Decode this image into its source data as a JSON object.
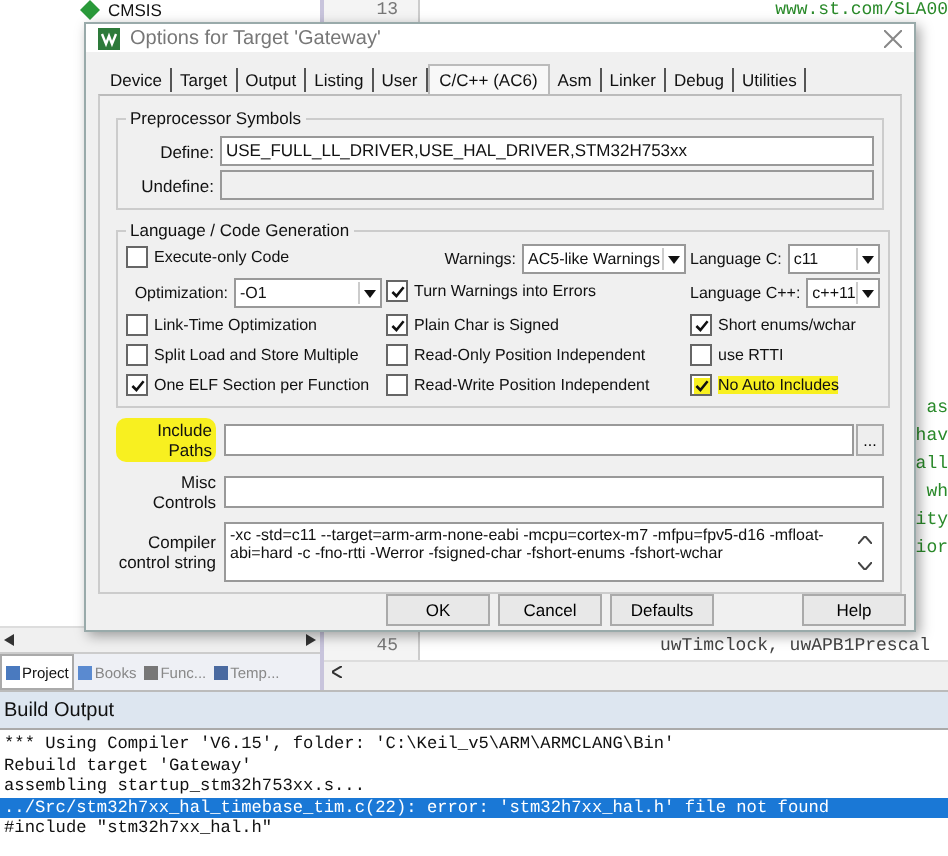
{
  "ide": {
    "tree_item": "CMSIS",
    "top_line_numbers": [
      "13"
    ],
    "top_code": "www.st.com/SLA00",
    "right_code_fragments": [
      "as",
      "hav",
      "all",
      "wh",
      "ity",
      "ior"
    ],
    "bottom_line_numbers": [
      "45"
    ],
    "bottom_code": "uwTimclock, uwAPB1Prescal",
    "panel_tabs": [
      {
        "label": "Project",
        "selected": true
      },
      {
        "label": "Books",
        "selected": false
      },
      {
        "label": "Func...",
        "selected": false
      },
      {
        "label": "Temp...",
        "selected": false
      }
    ]
  },
  "dialog": {
    "title": "Options for Target 'Gateway'",
    "tabs": [
      {
        "label": "Device",
        "selected": false
      },
      {
        "label": "Target",
        "selected": false
      },
      {
        "label": "Output",
        "selected": false
      },
      {
        "label": "Listing",
        "selected": false
      },
      {
        "label": "User",
        "selected": false
      },
      {
        "label": "C/C++ (AC6)",
        "selected": true
      },
      {
        "label": "Asm",
        "selected": false
      },
      {
        "label": "Linker",
        "selected": false
      },
      {
        "label": "Debug",
        "selected": false
      },
      {
        "label": "Utilities",
        "selected": false
      }
    ],
    "preprocessor": {
      "title": "Preprocessor Symbols",
      "fields": [
        {
          "label": "Define:",
          "value": "USE_FULL_LL_DRIVER,USE_HAL_DRIVER,STM32H753xx"
        },
        {
          "label": "Undefine:"
        }
      ]
    },
    "language": {
      "title": "Language / Code Generation",
      "items": [
        {
          "kind": "checkbox",
          "label": "Execute-only Code",
          "checked": false,
          "highlighted": false
        },
        {
          "kind": "select",
          "label": "Warnings:",
          "value": "AC5-like Warnings"
        },
        {
          "kind": "select",
          "label": "Language C:",
          "value": "c11"
        },
        {
          "kind": "select",
          "label": "Optimization:",
          "value": "-O1"
        },
        {
          "kind": "checkbox",
          "label": "Turn Warnings into Errors",
          "checked": true,
          "highlighted": false
        },
        {
          "kind": "select",
          "label": "Language C++:",
          "value": "c++11"
        },
        {
          "kind": "checkbox",
          "label": "Link-Time Optimization",
          "checked": false,
          "highlighted": false
        },
        {
          "kind": "checkbox",
          "label": "Plain Char is Signed",
          "checked": true,
          "highlighted": false
        },
        {
          "kind": "checkbox",
          "label": "Short enums/wchar",
          "checked": true,
          "highlighted": false
        },
        {
          "kind": "checkbox",
          "label": "Split Load and Store Multiple",
          "checked": false,
          "highlighted": false
        },
        {
          "kind": "checkbox",
          "label": "Read-Only Position Independent",
          "checked": false,
          "highlighted": false
        },
        {
          "kind": "checkbox",
          "label": "use RTTI",
          "checked": false,
          "highlighted": false
        },
        {
          "kind": "checkbox",
          "label": "One ELF Section per Function",
          "checked": true,
          "highlighted": false
        },
        {
          "kind": "checkbox",
          "label": "Read-Write Position Independent",
          "checked": false,
          "highlighted": false
        },
        {
          "kind": "checkbox",
          "label": "No Auto Includes",
          "checked": true,
          "highlighted": true
        }
      ]
    },
    "include_paths": {
      "label": "Include Paths",
      "highlighted": true,
      "browse": "..."
    },
    "misc_controls": {
      "label": "Misc Controls",
      "highlighted": false
    },
    "compiler_control_string": {
      "label": "Compiler control string",
      "value": "-xc -std=c11 --target=arm-arm-none-eabi -mcpu=cortex-m7 -mfpu=fpv5-d16 -mfloat-abi=hard -c -fno-rtti -Werror -fsigned-char -fshort-enums -fshort-wchar"
    },
    "buttons": [
      "OK",
      "Cancel",
      "Defaults",
      "Help"
    ]
  },
  "build_output": {
    "title": "Build Output",
    "lines": [
      {
        "text": "*** Using Compiler 'V6.15', folder: 'C:\\Keil_v5\\ARM\\ARMCLANG\\Bin'",
        "selected": false
      },
      {
        "text": "Rebuild target 'Gateway'",
        "selected": false
      },
      {
        "text": "assembling startup_stm32h753xx.s...",
        "selected": false
      },
      {
        "text": "../Src/stm32h7xx_hal_timebase_tim.c(22): error: 'stm32h7xx_hal.h' file not found",
        "selected": true
      },
      {
        "text": "#include \"stm32h7xx_hal.h\"",
        "selected": false
      }
    ]
  }
}
